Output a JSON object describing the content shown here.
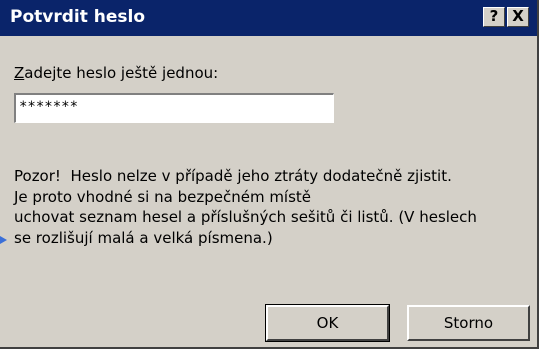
{
  "dialog": {
    "title": "Potvrdit heslo",
    "help_label": "?",
    "close_label": "X"
  },
  "prompt": {
    "first_letter": "Z",
    "rest": "adejte heslo ještě jednou:"
  },
  "password_field": {
    "value": "*******"
  },
  "warning": {
    "lines": [
      "Pozor!  Heslo nelze v případě jeho ztráty dodatečně zjistit.",
      "Je proto vhodné si na bezpečném místě",
      "uchovat seznam hesel a příslušných sešitů či listů. (V heslech",
      "se rozlišují malá a velká písmena.)"
    ]
  },
  "buttons": {
    "ok_label": "OK",
    "cancel_label": "Storno"
  },
  "colors": {
    "titlebar": "#0a246a",
    "face": "#d4d0c8",
    "marker": "#3a6fd8"
  }
}
